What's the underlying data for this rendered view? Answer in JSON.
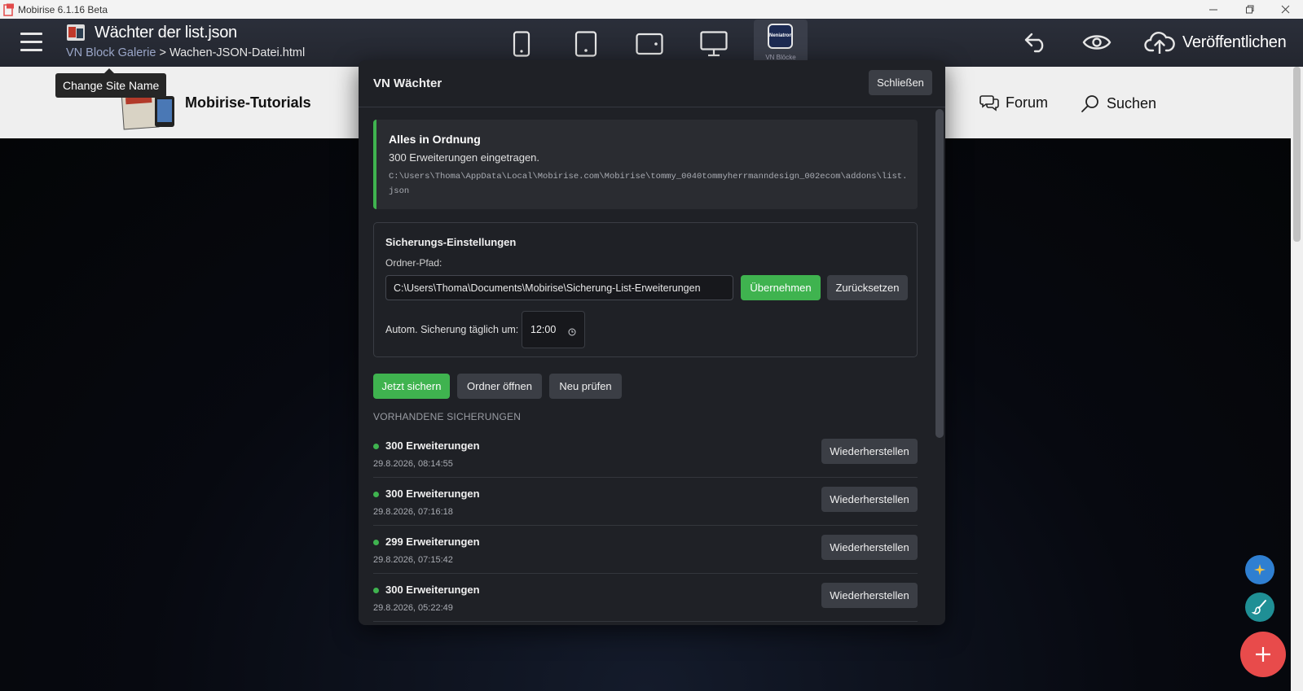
{
  "window": {
    "title": "Mobirise 6.1.16 Beta"
  },
  "toolbar": {
    "page_title": "Wächter der list.json",
    "breadcrumb_site": "VN Block Galerie",
    "breadcrumb_separator": ">",
    "breadcrumb_page": "Wachen-JSON-Datei.html",
    "extension_label": "VN Blöcke",
    "extension_thumb_text": "Neniatron",
    "publish_label": "Veröffentlichen",
    "device_icons": [
      "phone-icon",
      "tablet-icon",
      "tablet-landscape-icon",
      "desktop-icon"
    ]
  },
  "tooltip": {
    "text": "Change Site Name"
  },
  "site": {
    "name": "Mobirise-Tutorials",
    "nav": [
      {
        "label": "Forum",
        "icon": "chat-icon"
      },
      {
        "label": "Suchen",
        "icon": "search-icon"
      }
    ]
  },
  "modal": {
    "title": "VN Wächter",
    "close_label": "Schließen",
    "status": {
      "title": "Alles in Ordnung",
      "count_text": "300 Erweiterungen eingetragen.",
      "path": "C:\\Users\\Thoma\\AppData\\Local\\Mobirise.com\\Mobirise\\tommy_0040tommyherrmanndesign_002ecom\\addons\\list.json"
    },
    "settings": {
      "title": "Sicherungs-Einstellungen",
      "folder_label": "Ordner-Pfad:",
      "folder_value": "C:\\Users\\Thoma\\Documents\\Mobirise\\Sicherung-List-Erweiterungen",
      "apply_label": "Übernehmen",
      "reset_label": "Zurücksetzen",
      "auto_label": "Autom. Sicherung täglich um:",
      "auto_time": "12:00"
    },
    "actions": {
      "backup_now": "Jetzt sichern",
      "open_folder": "Ordner öffnen",
      "recheck": "Neu prüfen"
    },
    "backups_section_label": "VORHANDENE SICHERUNGEN",
    "restore_label": "Wiederherstellen",
    "backups": [
      {
        "count": "300 Erweiterungen",
        "timestamp": "29.8.2026, 08:14:55"
      },
      {
        "count": "300 Erweiterungen",
        "timestamp": "29.8.2026, 07:16:18"
      },
      {
        "count": "299 Erweiterungen",
        "timestamp": "29.8.2026, 07:15:42"
      },
      {
        "count": "300 Erweiterungen",
        "timestamp": "29.8.2026, 05:22:49"
      }
    ]
  },
  "colors": {
    "accent_green": "#3fb34f",
    "fab_red": "#e84b4b",
    "fab_blue": "#2f7fd1",
    "fab_teal": "#1f8f95"
  }
}
